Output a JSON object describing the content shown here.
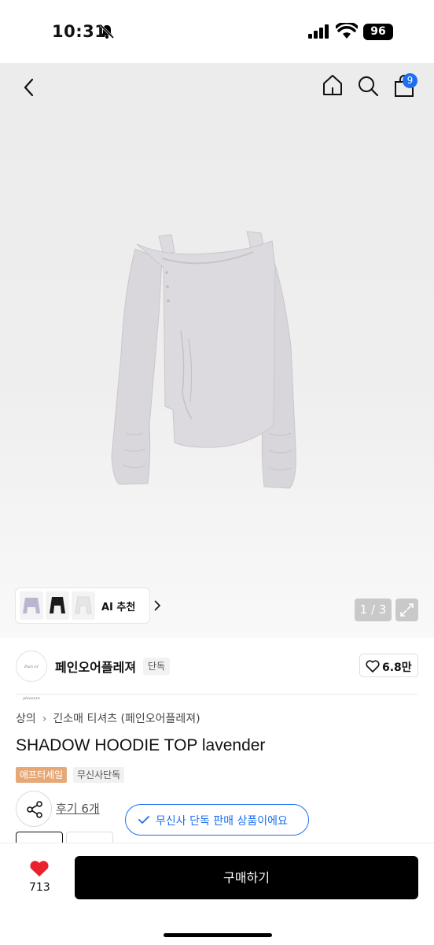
{
  "status_bar": {
    "time": "10:31",
    "battery": "96"
  },
  "header": {
    "cart_count": "9"
  },
  "gallery": {
    "ai_label": "AI 추천",
    "pager": "1 / 3"
  },
  "brand": {
    "logo_text": "Pain or pleasure",
    "name": "페인오어플레져",
    "tag": "단독",
    "likes": "6.8만"
  },
  "breadcrumb": [
    "상의",
    "긴소매 티셔츠 (페인오어플레져)"
  ],
  "product": {
    "title": "SHADOW HOODIE TOP lavender",
    "tags": [
      "애프터세일",
      "무신사단독"
    ],
    "review_link": "후기 6개",
    "exclusive_notice": "무신사 단독 판매 상품이에요"
  },
  "bottom_bar": {
    "heart_count": "713",
    "buy_label": "구매하기"
  },
  "colors": {
    "accent_blue": "#1c6ff0",
    "sale_tag": "#e7a877",
    "heart_red": "#e8232e",
    "garment_lavender": "#d9d7dc"
  }
}
